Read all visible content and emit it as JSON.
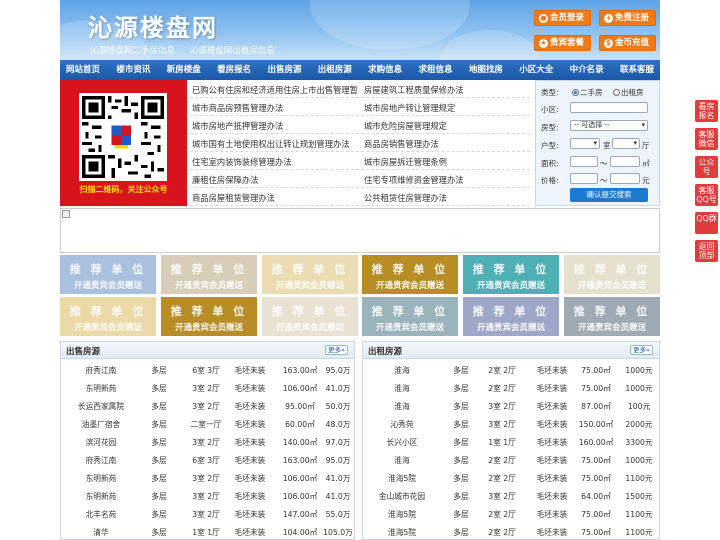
{
  "header": {
    "title": "沁源楼盘网",
    "subtitle": [
      "沁源楼盘网二手房信息",
      "沁源楼盘网出租房信息"
    ],
    "buttons": [
      {
        "label": "会员登录",
        "icon": "user-icon"
      },
      {
        "label": "免费注册",
        "icon": "register-icon"
      },
      {
        "label": "贵宾套餐",
        "icon": "vip-icon"
      },
      {
        "label": "金币充值",
        "icon": "coin-icon"
      }
    ],
    "accent": "#f07a18"
  },
  "nav": [
    "网站首页",
    "楼市资讯",
    "新房楼盘",
    "看房报名",
    "出售房源",
    "出租房源",
    "求购信息",
    "求租信息",
    "地图找房",
    "小区大全",
    "中介名录",
    "联系客服"
  ],
  "qr": {
    "caption": "扫描二维码，关注公众号"
  },
  "links": [
    [
      "已购公有住房和经济适用住房上市出售管理暂",
      "房屋建筑工程质量保修办法"
    ],
    [
      "城市商品房预售管理办法",
      "城市房地产转让管理规定"
    ],
    [
      "城市房地产抵押管理办法",
      "城市危险房屋管理规定"
    ],
    [
      "城市国有土地使用权出让转让规划管理办法",
      "商品房销售管理办法"
    ],
    [
      "住宅室内装饰装修管理办法",
      "城市房屋拆迁管理条例"
    ],
    [
      "廉租住房保障办法",
      "住宅专项维修资金管理办法"
    ],
    [
      "商品房屋租赁管理办法",
      "公共租赁住房管理办法"
    ]
  ],
  "search": {
    "type_label": "类型:",
    "type_options": [
      "二手房",
      "出租房"
    ],
    "community_label": "小区:",
    "layout_label": "房型:",
    "layout_select": "-- 可选择 --",
    "unit_label": "户型:",
    "unit_room": "室",
    "unit_hall": "厅",
    "area_label": "面积:",
    "area_unit": "㎡",
    "price_label": "价格:",
    "price_unit": "元",
    "range_sep": "～",
    "submit": "确认提交搜索"
  },
  "tiles": {
    "line1": "推 荐 单 位",
    "line2": "开通贵宾会员赠送",
    "colors": [
      [
        "#a9c0de",
        "#d8cdb8",
        "#ecdcb3",
        "#b88d26",
        "#4eb0b5",
        "#e6e0cf"
      ],
      [
        "#ecd9a8",
        "#b88d26",
        "#e9e2d2",
        "#9ab3bd",
        "#9fa7c9",
        "#a0aab4"
      ]
    ]
  },
  "side_float": [
    "看房报名",
    "客服微信",
    "公众号",
    "客服QQ号",
    "QQ群",
    "返回顶部"
  ],
  "sale": {
    "title": "出售房源",
    "more": "更多»",
    "rows": [
      [
        "府秀江南",
        "多层",
        "6室 3厅",
        "毛坯未装",
        "163.00㎡",
        "95.0万"
      ],
      [
        "东明新苑",
        "多层",
        "3室 2厅",
        "毛坯未装",
        "106.00㎡",
        "41.0万"
      ],
      [
        "长运西家属院",
        "多层",
        "3室 2厅",
        "毛坯未装",
        "95.00㎡",
        "50.0万"
      ],
      [
        "油墨厂宿舍",
        "多层",
        "二室一厅",
        "毛坯未装",
        "60.00㎡",
        "48.0万"
      ],
      [
        "滨河花园",
        "多层",
        "3室 2厅",
        "毛坯未装",
        "140.00㎡",
        "97.0万"
      ],
      [
        "府秀江南",
        "多层",
        "6室 3厅",
        "毛坯未装",
        "163.00㎡",
        "95.0万"
      ],
      [
        "东明新苑",
        "多层",
        "3室 2厅",
        "毛坯未装",
        "106.00㎡",
        "41.0万"
      ],
      [
        "东明新苑",
        "多层",
        "3室 2厅",
        "毛坯未装",
        "106.00㎡",
        "41.0万"
      ],
      [
        "北丰名苑",
        "多层",
        "3室 2厅",
        "毛坯未装",
        "147.00㎡",
        "55.0万"
      ],
      [
        "清华",
        "多层",
        "1室 1厅",
        "毛坯未装",
        "104.00㎡",
        "105.0万"
      ]
    ]
  },
  "rent": {
    "title": "出租房源",
    "more": "更多»",
    "rows": [
      [
        "淮海",
        "多层",
        "2室 2厅",
        "毛坯未装",
        "75.00㎡",
        "1000元"
      ],
      [
        "淮海",
        "多层",
        "2室 2厅",
        "毛坯未装",
        "75.00㎡",
        "1000元"
      ],
      [
        "淮海",
        "多层",
        "3室 2厅",
        "毛坯未装",
        "87.00㎡",
        "100元"
      ],
      [
        "沁秀苑",
        "多层",
        "3室 2厅",
        "毛坯未装",
        "150.00㎡",
        "2000元"
      ],
      [
        "长兴小区",
        "多层",
        "1室 1厅",
        "毛坯未装",
        "160.00㎡",
        "3300元"
      ],
      [
        "淮海",
        "多层",
        "2室 2厅",
        "毛坯未装",
        "75.00㎡",
        "1000元"
      ],
      [
        "淮海5院",
        "多层",
        "2室 2厅",
        "毛坯未装",
        "75.00㎡",
        "1100元"
      ],
      [
        "金山城市花园",
        "多层",
        "3室 2厅",
        "毛坯未装",
        "64.00㎡",
        "1500元"
      ],
      [
        "淮海5院",
        "多层",
        "2室 2厅",
        "毛坯未装",
        "75.00㎡",
        "1100元"
      ],
      [
        "淮海5院",
        "多层",
        "2室 2厅",
        "毛坯未装",
        "75.00㎡",
        "1100元"
      ]
    ]
  }
}
